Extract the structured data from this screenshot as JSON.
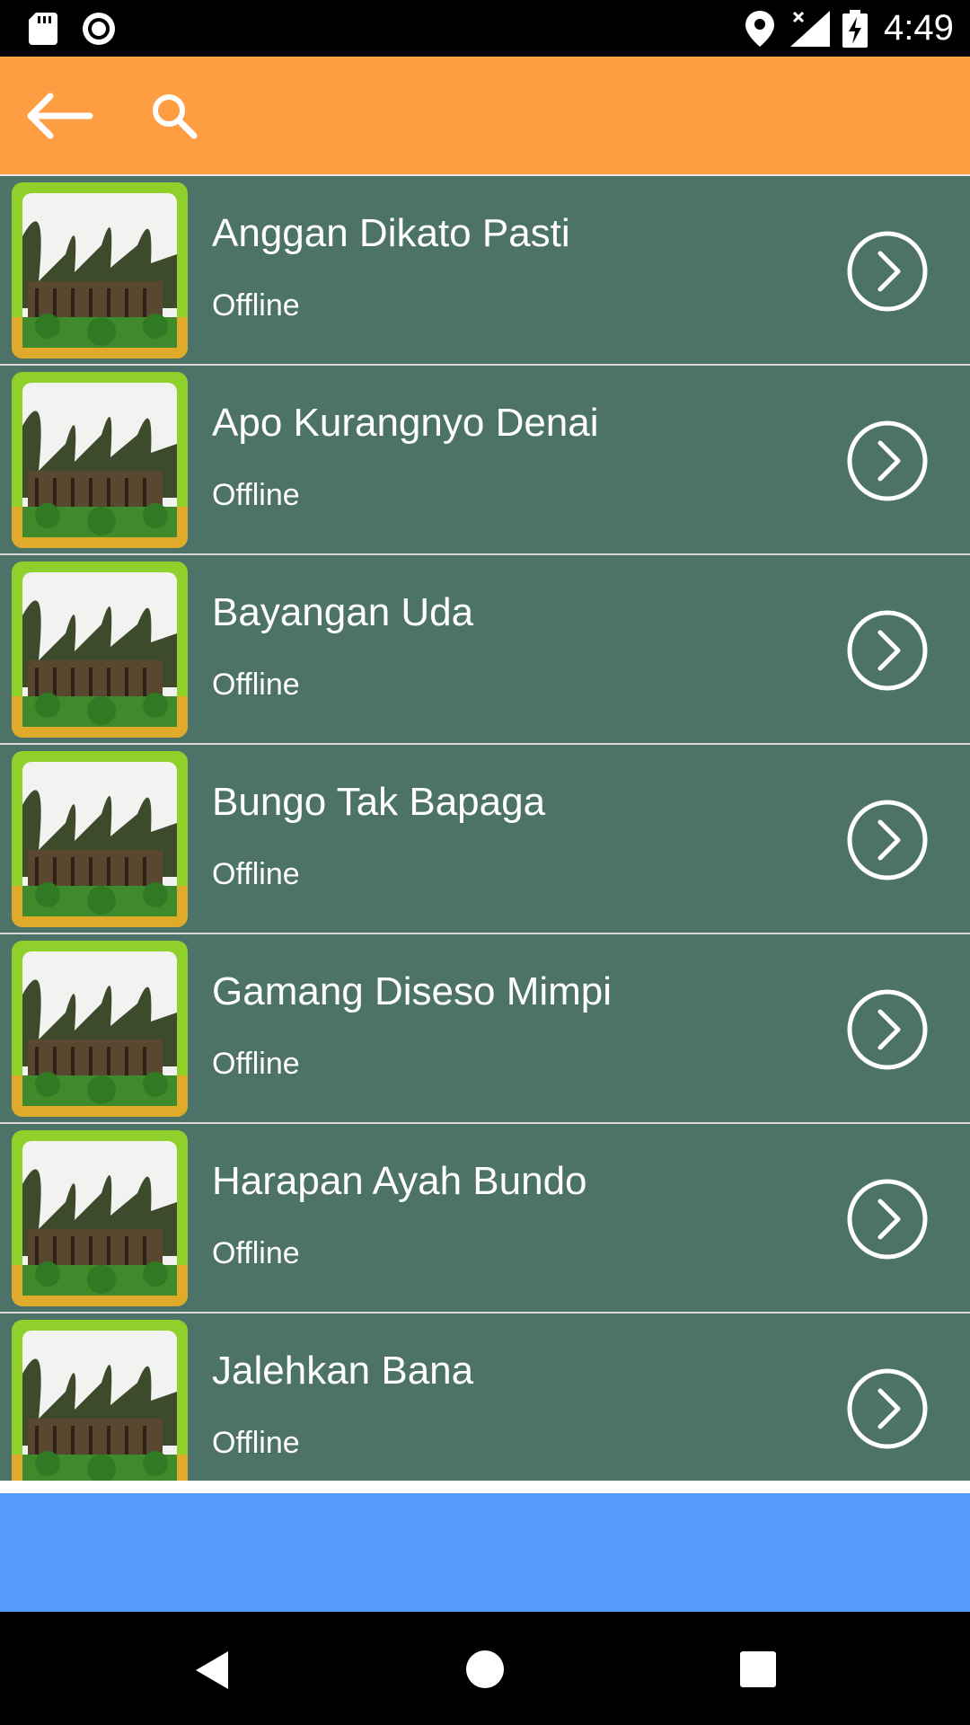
{
  "status_bar": {
    "time": "4:49",
    "icons": [
      "sd-card-icon",
      "record-icon",
      "location-icon",
      "signal-icon",
      "battery-charging-icon"
    ]
  },
  "app_bar": {
    "back_icon": "arrow-left-icon",
    "search_icon": "search-icon",
    "background_color": "#ff9d43"
  },
  "list": {
    "background_color": "#4d7368",
    "items": [
      {
        "title": "Anggan Dikato Pasti",
        "subtitle": "Offline"
      },
      {
        "title": "Apo Kurangnyo Denai",
        "subtitle": "Offline"
      },
      {
        "title": "Bayangan Uda",
        "subtitle": "Offline"
      },
      {
        "title": "Bungo Tak Bapaga",
        "subtitle": "Offline"
      },
      {
        "title": "Gamang Diseso Mimpi",
        "subtitle": "Offline"
      },
      {
        "title": "Harapan Ayah Bundo",
        "subtitle": "Offline"
      },
      {
        "title": "Jalehkan Bana",
        "subtitle": "Offline"
      }
    ]
  },
  "banner": {
    "background_color": "#549bfb"
  },
  "nav_bar": {
    "icons": [
      "back-triangle-icon",
      "home-circle-icon",
      "recents-square-icon"
    ]
  }
}
